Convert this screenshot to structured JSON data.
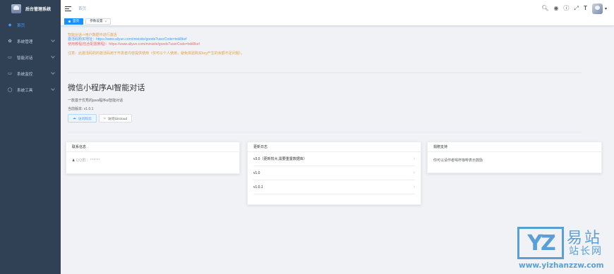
{
  "sidebar": {
    "title": "后台管理系统",
    "items": [
      {
        "label": "首页",
        "icon": "dashboard-icon",
        "glyph": "◆"
      },
      {
        "label": "系统管理",
        "icon": "gear-icon",
        "glyph": "✿"
      },
      {
        "label": "智能对话",
        "icon": "chat-icon",
        "glyph": "▭"
      },
      {
        "label": "系统监控",
        "icon": "monitor-icon",
        "glyph": "▭"
      },
      {
        "label": "系统工具",
        "icon": "tool-icon",
        "glyph": "◯"
      }
    ]
  },
  "navbar": {
    "breadcrumb": "首页",
    "icons": [
      "search-icon",
      "github-icon",
      "question-icon",
      "fullscreen-icon",
      "font-size-icon"
    ]
  },
  "tags": [
    {
      "label": "首页"
    },
    {
      "label": "参数设置"
    }
  ],
  "notice": {
    "line1": "智能对话->用户数据中进行激活",
    "line2": "激活码购买地址：https://www.aliyun.com/minisite/goods?userCode=txkl8kef",
    "line3": "使用教程(包含配置教程)：https://www.aliyun.com/minisite/goods?userCode=txkl8kef",
    "line4": "注意：此激活码的的激活码用于开发者内容提供使用（仅可以个人使用，避免体验购买key产生的余额不足问题）。"
  },
  "intro": {
    "title": "微信小程序AI智能对话",
    "desc": "一款基于优秀的java程序ai智能对话",
    "version": "当前版本: v1.0.1",
    "btn_visit": "访问码云",
    "btn_gitee": "访问Gitcloud"
  },
  "cards": {
    "contact": {
      "title": "联系信息",
      "content": "QQ群：******"
    },
    "changelog": {
      "title": "更新日志",
      "items": [
        "v3.0（更新较大,需要重置数据库）",
        "v1.0",
        "v1.0.1"
      ]
    },
    "donate": {
      "title": "捐赠支持",
      "content": "你可以请作者喝杯咖啡表示鼓励"
    }
  },
  "watermark": {
    "logo": "YZ",
    "big": "易站",
    "small": "站长网",
    "url": "www.yizhanzzw.com"
  },
  "colors": {
    "sidebar_bg": "#304156",
    "accent": "#409eff",
    "warning": "#e6a23c"
  }
}
